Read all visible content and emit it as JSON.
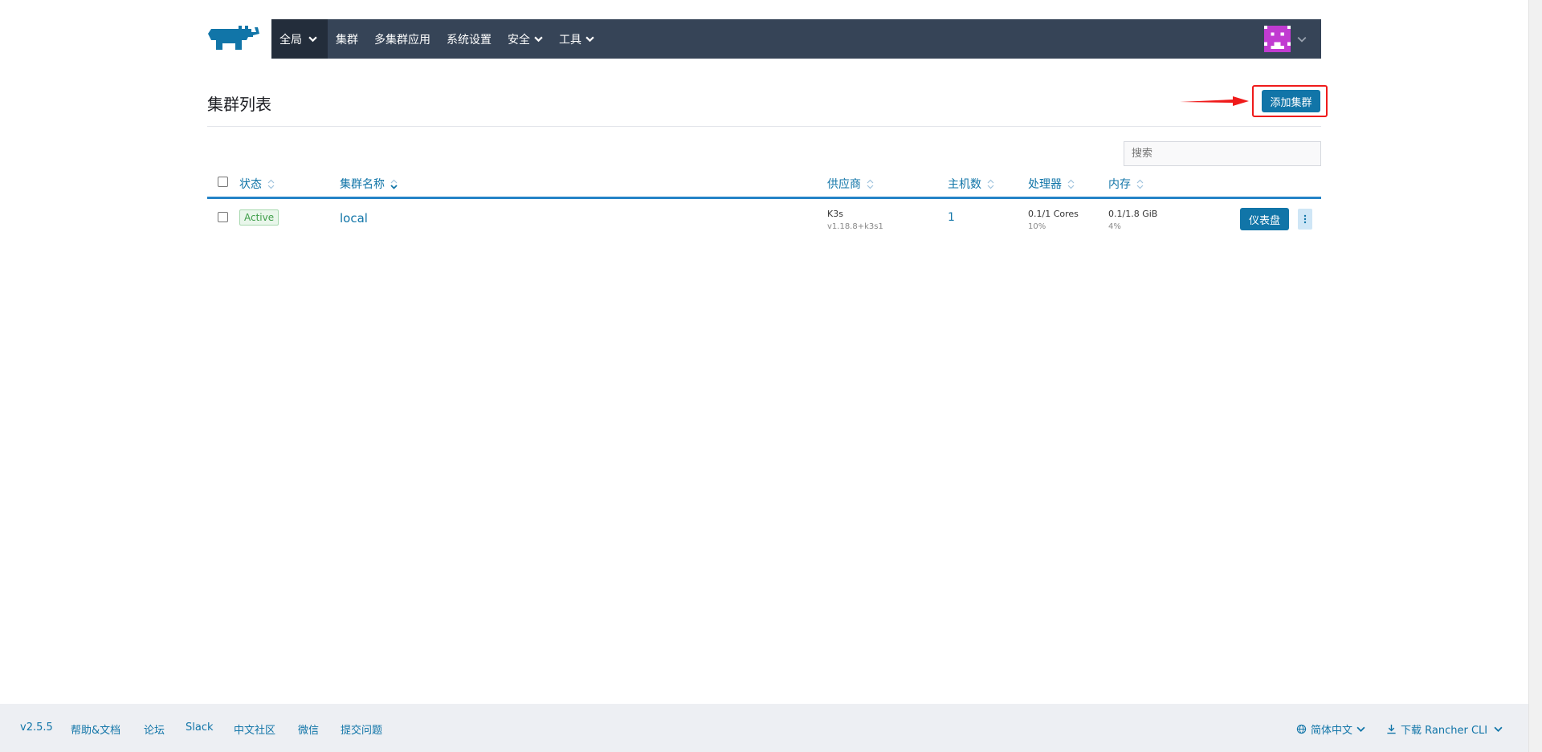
{
  "header": {
    "logo": "rancher-cow-logo",
    "nav": [
      {
        "label": "全局",
        "has_dropdown": true,
        "active": true
      },
      {
        "label": "集群",
        "has_dropdown": false
      },
      {
        "label": "多集群应用",
        "has_dropdown": false
      },
      {
        "label": "系统设置",
        "has_dropdown": false
      },
      {
        "label": "安全",
        "has_dropdown": true
      },
      {
        "label": "工具",
        "has_dropdown": true
      }
    ],
    "avatar": "pixel-avatar"
  },
  "page": {
    "title": "集群列表",
    "add_button": "添加集群"
  },
  "search": {
    "placeholder": "搜索"
  },
  "table": {
    "columns": [
      "状态",
      "集群名称",
      "供应商",
      "主机数",
      "处理器",
      "内存"
    ],
    "rows": [
      {
        "state": "Active",
        "name": "local",
        "provider": "K3s",
        "provider_version": "v1.18.8+k3s1",
        "nodes": "1",
        "cpu": "0.1/1 Cores",
        "cpu_pct": "10%",
        "memory": "0.1/1.8 GiB",
        "memory_pct": "4%",
        "action": "仪表盘"
      }
    ]
  },
  "footer": {
    "version": "v2.5.5",
    "links": [
      "帮助&文档",
      "论坛",
      "Slack",
      "中文社区",
      "微信",
      "提交问题"
    ],
    "language": "简体中文",
    "cli": "下载 Rancher CLI"
  },
  "colors": {
    "nav_bg": "#364457",
    "nav_active_bg": "#232d3b",
    "primary": "#1175a8",
    "highlight": "#ef1b1b",
    "active_badge": "#3e9e49",
    "footer_bg": "#edeff3"
  }
}
